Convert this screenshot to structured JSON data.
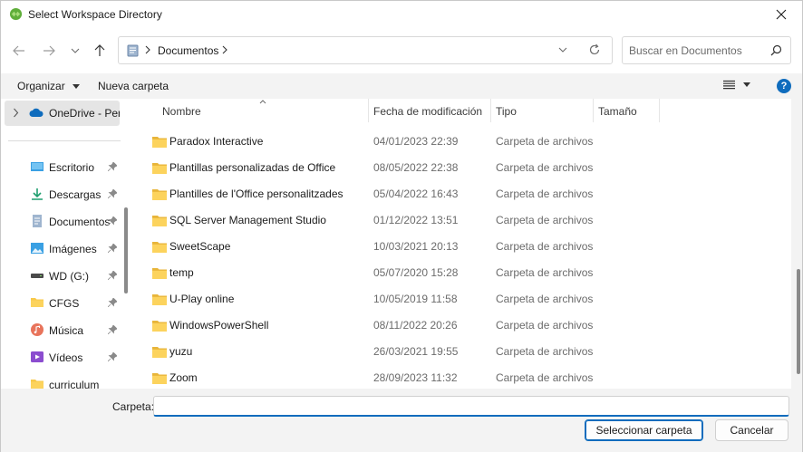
{
  "window": {
    "title": "Select Workspace Directory"
  },
  "address": {
    "crumb": "Documentos",
    "search_placeholder": "Buscar en Documentos"
  },
  "toolbar": {
    "organize_label": "Organizar",
    "new_folder_label": "Nueva carpeta",
    "help_glyph": "?"
  },
  "nav": {
    "onedrive_label": "OneDrive - Personal",
    "items": [
      {
        "label": "Escritorio",
        "icon": "desktop-icon",
        "pinned": true
      },
      {
        "label": "Descargas",
        "icon": "download-icon",
        "pinned": true
      },
      {
        "label": "Documentos",
        "icon": "document-icon",
        "pinned": true
      },
      {
        "label": "Imágenes",
        "icon": "picture-icon",
        "pinned": true
      },
      {
        "label": "WD (G:)",
        "icon": "drive-icon",
        "pinned": true
      },
      {
        "label": "CFGS",
        "icon": "folder-icon",
        "pinned": true
      },
      {
        "label": "Música",
        "icon": "music-icon",
        "pinned": true
      },
      {
        "label": "Vídeos",
        "icon": "video-icon",
        "pinned": true
      },
      {
        "label": "curriculum",
        "icon": "folder-icon",
        "pinned": false
      }
    ]
  },
  "columns": {
    "name": "Nombre",
    "modified": "Fecha de modificación",
    "type": "Tipo",
    "size": "Tamaño"
  },
  "files": [
    {
      "name": "Paradox Interactive",
      "date": "04/01/2023 22:39",
      "type": "Carpeta de archivos"
    },
    {
      "name": "Plantillas personalizadas de Office",
      "date": "08/05/2022 22:38",
      "type": "Carpeta de archivos"
    },
    {
      "name": "Plantilles de l'Office personalitzades",
      "date": "05/04/2022 16:43",
      "type": "Carpeta de archivos"
    },
    {
      "name": "SQL Server Management Studio",
      "date": "01/12/2022 13:51",
      "type": "Carpeta de archivos"
    },
    {
      "name": "SweetScape",
      "date": "10/03/2021 20:13",
      "type": "Carpeta de archivos"
    },
    {
      "name": "temp",
      "date": "05/07/2020 15:28",
      "type": "Carpeta de archivos"
    },
    {
      "name": "U-Play online",
      "date": "10/05/2019 11:58",
      "type": "Carpeta de archivos"
    },
    {
      "name": "WindowsPowerShell",
      "date": "08/11/2022 20:26",
      "type": "Carpeta de archivos"
    },
    {
      "name": "yuzu",
      "date": "26/03/2021 19:55",
      "type": "Carpeta de archivos"
    },
    {
      "name": "Zoom",
      "date": "28/09/2023 11:32",
      "type": "Carpeta de archivos"
    }
  ],
  "footer": {
    "folder_label": "Carpeta:",
    "folder_value": "",
    "select_button": "Seleccionar carpeta",
    "cancel_button": "Cancelar"
  },
  "colors": {
    "accent": "#0f6cbd",
    "folder": "#f8c94a"
  }
}
